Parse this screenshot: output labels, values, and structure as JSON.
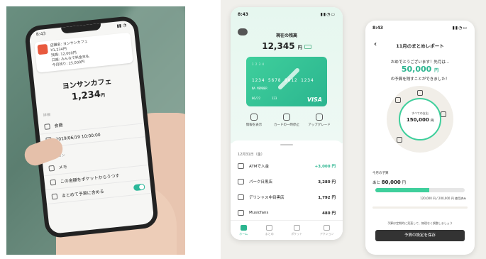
{
  "left_phone": {
    "time": "8:43",
    "notification_lines": [
      "店舗名: ヨンサンカフェ",
      "¥1,234円",
      "残高: 12,000円",
      "口座: みんなで料金支払",
      "今月残り: 25,000円"
    ],
    "merchant": "ヨンサンカフェ",
    "amount": "1,234",
    "yen": "円",
    "section1": "詳細",
    "category": "食費",
    "datetime": "2019/06/19 10:00:00",
    "section2": "アクション",
    "memo": "メモ",
    "move_pocket": "この金額をポケットからうつす",
    "include_budget": "まとめて予算に含める"
  },
  "balance_phone": {
    "time": "8:43",
    "balance_label": "現在の残高",
    "balance": "12,345",
    "yen": "円",
    "card": {
      "top": "1 2 3 4",
      "number": "1234 5678 9012 1234",
      "name": "NA MEMBER",
      "expiry": "06/22",
      "cvv": "123",
      "brand": "VISA"
    },
    "actions": [
      "情報を表示",
      "カードの一時停止",
      "アップグレード"
    ],
    "date": "12月31日（金）",
    "transactions": [
      {
        "name": "ATMで入金",
        "amount": "+3,000 円"
      },
      {
        "name": "パーク日黒店",
        "amount": "3,280 円"
      },
      {
        "name": "デリシャス中目黒店",
        "amount": "1,792 円"
      },
      {
        "name": "Musicfans",
        "amount": "480 円"
      }
    ],
    "tabs": [
      "ホーム",
      "まとめ",
      "ポケット",
      "アクション"
    ]
  },
  "report_phone": {
    "time": "8:43",
    "title": "11月のまとめレポート",
    "congrats": "おめでとうございます！先月は...",
    "saved_amount": "50,000",
    "yen": "円",
    "saved_text": "の予算を残すことができました！",
    "total_label": "すべての支出",
    "total_value": "150,000",
    "budget_label": "今月の予算",
    "remaining_prefix": "あと",
    "remaining_value": "80,000",
    "remaining_unit": "円",
    "progress_fraction": 0.6,
    "budget_note": "120,000 円 / 200,000 円 使用済み",
    "auto_note": "予算は定期的に見直して、無理なく調整しましょう",
    "save_button": "予算の設定を保存"
  },
  "colors": {
    "accent": "#2bb58f",
    "card": "#3fcf9c",
    "dark_button": "#333333"
  }
}
